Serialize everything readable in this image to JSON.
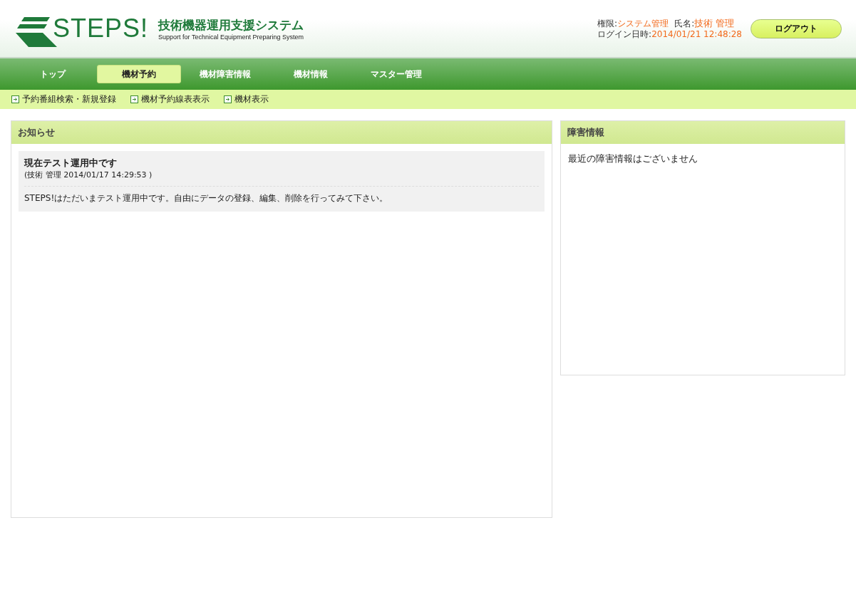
{
  "header": {
    "logo_text": "STEPS!",
    "system_title": "技術機器運用支援システム",
    "system_subtitle": "Support for Technical Equipment Preparing System",
    "user_info": {
      "role_label": "権限:",
      "role": "システム管理",
      "name_label": "氏名:",
      "name": "技術 管理",
      "login_label": "ログイン日時:",
      "login_time": "2014/01/21 12:48:28"
    },
    "logout_button": "ログアウト"
  },
  "nav": [
    {
      "label": "トップ",
      "selected": false
    },
    {
      "label": "機材予約",
      "selected": true
    },
    {
      "label": "機材障害情報",
      "selected": false
    },
    {
      "label": "機材情報",
      "selected": false
    },
    {
      "label": "マスター管理",
      "selected": false
    }
  ],
  "subnav": [
    "予約番組検索・新規登録",
    "機材予約線表表示",
    "機材表示"
  ],
  "notices_panel": {
    "title": "お知らせ",
    "notices": [
      {
        "title": "現在テスト運用中です",
        "meta": "(技術 管理 2014/01/17 14:29:53 )",
        "body": "STEPS!はただいまテスト運用中です。自由にデータの登録、編集、削除を行ってみて下さい。"
      }
    ]
  },
  "failure_panel": {
    "title": "障害情報",
    "message": "最近の障害情報はございません"
  }
}
